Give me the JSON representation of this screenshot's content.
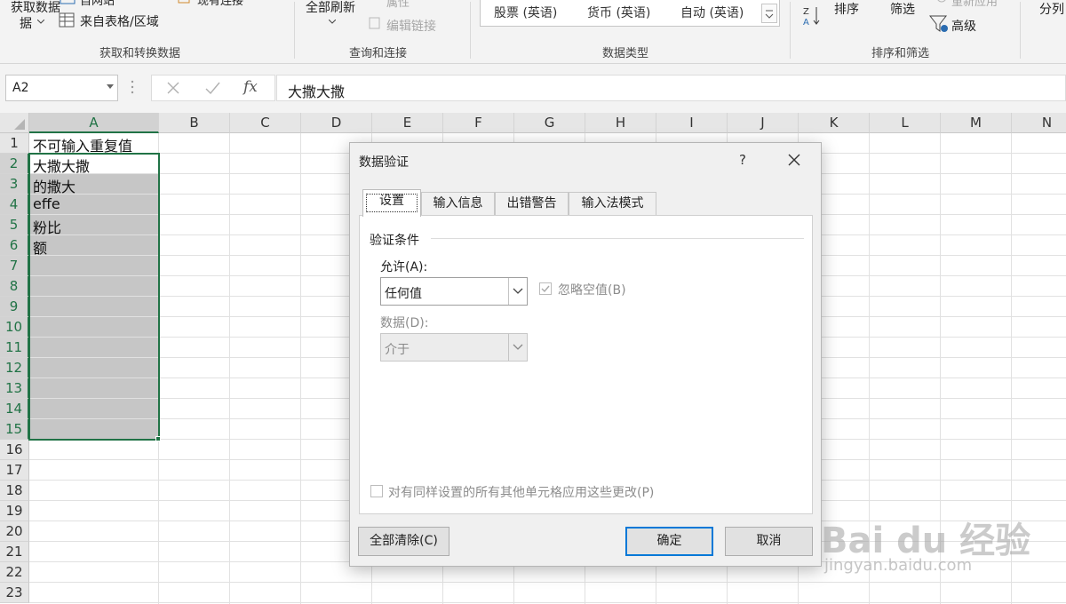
{
  "ribbon": {
    "get_data_label": "获取数据",
    "get_data_label2": "据",
    "from_table": "来自表格/区域",
    "partial_top1": "自网站",
    "partial_top2": "现有连接",
    "refresh_all": "全部刷新",
    "properties": "属性",
    "edit_links": "编辑链接",
    "data_types": [
      "股票 (英语)",
      "货币 (英语)",
      "自动 (英语)"
    ],
    "sort": "排序",
    "filter": "筛选",
    "reapply": "重新应用",
    "advanced": "高级",
    "split": "分列",
    "groups": {
      "get_transform": "获取和转换数据",
      "queries": "查询和连接",
      "data_types": "数据类型",
      "sort_filter": "排序和筛选"
    }
  },
  "formula_bar": {
    "name_box": "A2",
    "fx": "fx",
    "value": "大撒大撒"
  },
  "sheet": {
    "columns": [
      "A",
      "B",
      "C",
      "D",
      "E",
      "F",
      "G",
      "H",
      "I",
      "J",
      "K",
      "L",
      "M",
      "N"
    ],
    "rows": [
      "1",
      "2",
      "3",
      "4",
      "5",
      "6",
      "7",
      "8",
      "9",
      "10",
      "11",
      "12",
      "13",
      "14",
      "15",
      "16",
      "17",
      "18",
      "19",
      "20",
      "21",
      "22",
      "23"
    ],
    "cells": [
      "不可输入重复值",
      "大撒大撒",
      "的撒大",
      "effe",
      "粉比",
      "额"
    ]
  },
  "dialog": {
    "title": "数据验证",
    "help": "?",
    "tabs": [
      "设置",
      "输入信息",
      "出错警告",
      "输入法模式"
    ],
    "legend": "验证条件",
    "allow_label": "允许(A):",
    "allow_value": "任何值",
    "ignore_blank": "忽略空值(B)",
    "data_label": "数据(D):",
    "data_value": "介于",
    "apply_all": "对有同样设置的所有其他单元格应用这些更改(P)",
    "clear_all": "全部清除(C)",
    "ok": "确定",
    "cancel": "取消"
  },
  "watermark": {
    "brand": "Bai du 经验",
    "url": "jingyan.baidu.com"
  },
  "colors": {
    "accent_green": "#217346",
    "focus_blue": "#0078d7"
  }
}
